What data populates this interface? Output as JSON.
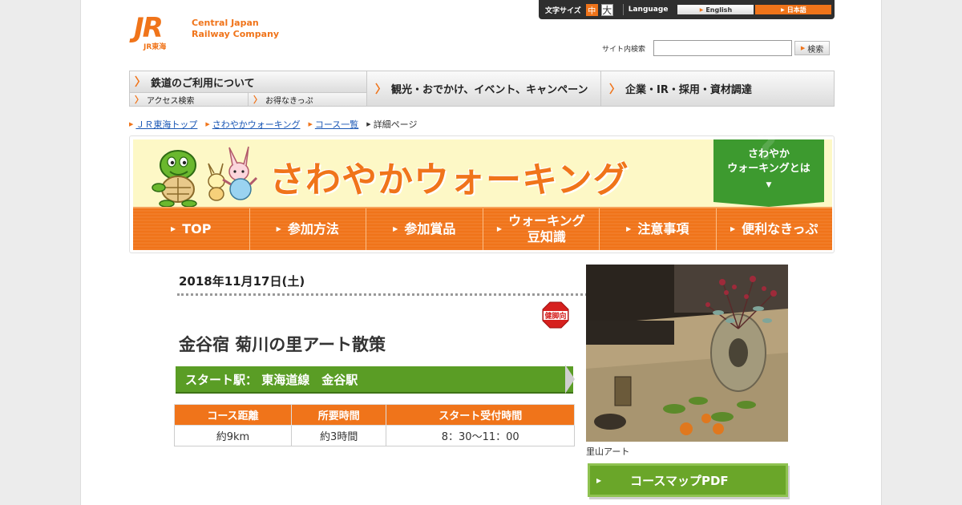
{
  "header": {
    "logo_mark": "JR",
    "logo_sub": "JR東海",
    "company_line1": "Central Japan",
    "company_line2": "Railway Company",
    "text_size_label": "文字サイズ",
    "size_mid": "中",
    "size_big": "大",
    "language_label": "Language",
    "lang_en": "English",
    "lang_jp": "日本語",
    "search_label": "サイト内検索",
    "search_value": "",
    "search_button": "検索"
  },
  "gnav": {
    "item1": "鉄道のご利用について",
    "item1_sub1": "アクセス検索",
    "item1_sub2": "お得なきっぷ",
    "item2": "観光・おでかけ、イベント、キャンペーン",
    "item3": "企業・IR・採用・資材調達"
  },
  "breadcrumb": [
    "ＪＲ東海トップ",
    "さわやかウォーキング",
    "コース一覧",
    "詳細ページ"
  ],
  "banner": {
    "title": "さわやかウォーキング",
    "about_line1": "さわやか",
    "about_line2": "ウォーキングとは"
  },
  "subnav": [
    {
      "line1": "TOP",
      "line2": ""
    },
    {
      "line1": "参加方法",
      "line2": ""
    },
    {
      "line1": "参加賞品",
      "line2": ""
    },
    {
      "line1": "ウォーキング",
      "line2": "豆知識"
    },
    {
      "line1": "注意事項",
      "line2": ""
    },
    {
      "line1": "便利なきっぷ",
      "line2": ""
    }
  ],
  "event": {
    "date": "2018年11月17日(土)",
    "badge": "健脚向",
    "title": "金谷宿 菊川の里アート散策",
    "start_station": "スタート駅： 東海道線　金谷駅"
  },
  "table": {
    "headers": [
      "コース距離",
      "所要時間",
      "スタート受付時間"
    ],
    "values": [
      "約9km",
      "約3時間",
      "8：30～11：00"
    ]
  },
  "photo": {
    "caption": "里山アート"
  },
  "pdf_button": "コースマップPDF",
  "colors": {
    "brand_orange": "#f0741a",
    "green": "#5a9d25",
    "link_blue": "#1a57b5"
  }
}
